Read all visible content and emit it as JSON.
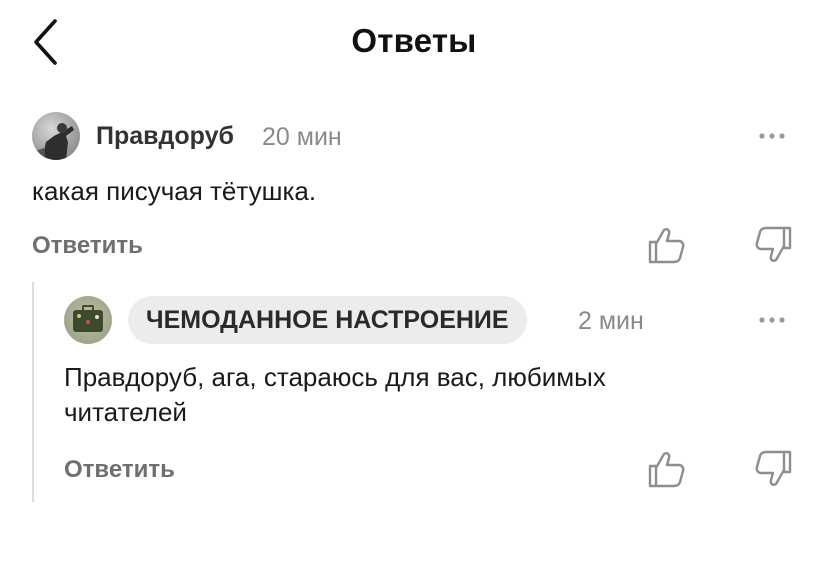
{
  "header": {
    "title": "Ответы"
  },
  "comments": [
    {
      "author": "Правдоруб",
      "time": "20 мин",
      "text": "какая писучая тётушка.",
      "reply_label": "Ответить"
    },
    {
      "author": "ЧЕМОДАННОЕ НАСТРОЕНИЕ",
      "time": "2 мин",
      "text": "Правдоруб, ага, стараюсь для вас, любимых читателей",
      "reply_label": "Ответить"
    }
  ],
  "colors": {
    "text": "#111111",
    "muted": "#8a8a8e",
    "chip": "#ececee",
    "thread_line": "#dcdcdc"
  },
  "icons": [
    "chevron-left-icon",
    "more-dots-icon",
    "thumbs-up-icon",
    "thumbs-down-icon"
  ]
}
